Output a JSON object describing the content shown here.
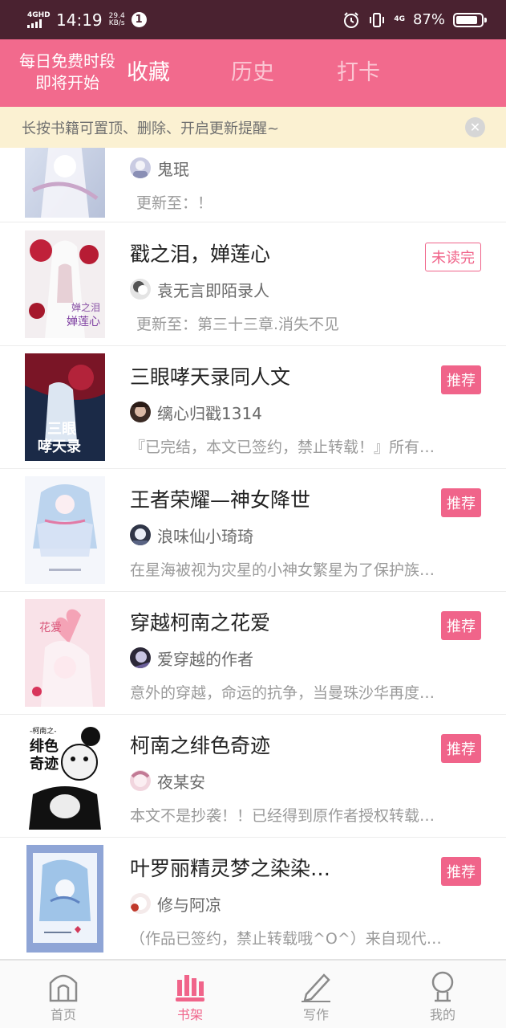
{
  "status_bar": {
    "network_label": "4GHD",
    "time": "14:19",
    "speed_value": "29.4",
    "speed_unit": "KB/s",
    "notification_count": "1",
    "network_right": "4G",
    "battery": "87%",
    "battery_level": 0.87
  },
  "header": {
    "promo_line1": "每日免费时段",
    "promo_line2": "即将开始",
    "tabs": [
      {
        "label": "收藏",
        "active": true
      },
      {
        "label": "历史",
        "active": false
      },
      {
        "label": "打卡",
        "active": false
      }
    ]
  },
  "tip": {
    "text": "长按书籍可置顶、删除、开启更新提醒~",
    "close_glyph": "✕"
  },
  "books": [
    {
      "title": "",
      "author": "鬼珉",
      "desc": "更新至：！",
      "badge": ""
    },
    {
      "title": "戳之泪，婵莲心",
      "author": "袁无言即陌录人",
      "desc": "更新至：第三十三章.消失不见",
      "badge": "未读完"
    },
    {
      "title": "三眼哮天录同人文",
      "author": "缡心归戳1314",
      "desc": "『已完结，本文已签约，禁止转载！』所有…",
      "badge": "推荐"
    },
    {
      "title": "王者荣耀—神女降世",
      "author": "浪味仙小琦琦",
      "desc": "在星海被视为灾星的小神女繁星为了保护族…",
      "badge": "推荐"
    },
    {
      "title": "穿越柯南之花爱",
      "author": "爱穿越的作者",
      "desc": "意外的穿越，命运的抗争，当曼珠沙华再度…",
      "badge": "推荐"
    },
    {
      "title": "柯南之绯色奇迹",
      "author": "夜某安",
      "desc": "本文不是抄袭！！已经得到原作者授权转载…",
      "badge": "推荐"
    },
    {
      "title": "叶罗丽精灵梦之染染…",
      "author": "修与阿凉",
      "desc": "（作品已签约，禁止转载哦^O^）来自现代…",
      "badge": "推荐"
    }
  ],
  "covers": {
    "c2_line1": "婵之泪",
    "c2_line2": "婵莲心",
    "c3_line1": "三眼",
    "c3_line2": "哮天录",
    "c5_text": "花爱",
    "c6_line0": "-柯南之-",
    "c6_line1": "绯色",
    "c6_line2": "奇迹"
  },
  "nav": [
    {
      "label": "首页",
      "icon": "home-icon",
      "active": false
    },
    {
      "label": "书架",
      "icon": "bookshelf-icon",
      "active": true
    },
    {
      "label": "写作",
      "icon": "pen-icon",
      "active": false
    },
    {
      "label": "我的",
      "icon": "profile-icon",
      "active": false
    }
  ],
  "colors": {
    "accent": "#f26a8d",
    "status_bar": "#4a2230",
    "tip_bg": "#fbf1d2"
  }
}
